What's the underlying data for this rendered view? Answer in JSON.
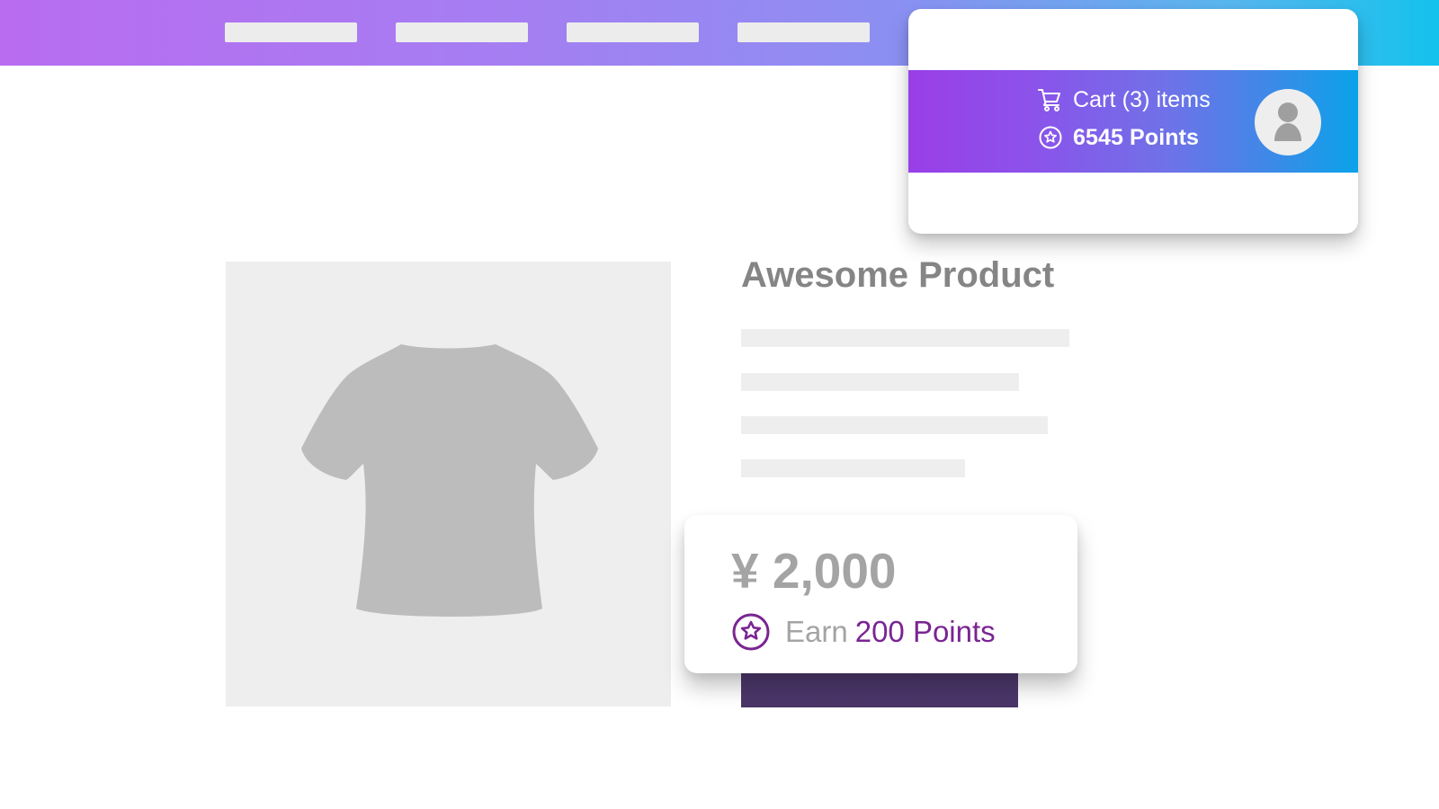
{
  "header": {
    "account_panel": {
      "cart_label": "Cart (3) items",
      "points_label": "6545 Points"
    }
  },
  "product": {
    "title": "Awesome Product",
    "price": "¥ 2,000",
    "earn_prefix": "Earn",
    "earn_points": "200 Points"
  },
  "icons": {
    "cart": "cart-icon",
    "points": "star-icon",
    "avatar": "user-icon",
    "product": "tshirt-icon"
  },
  "colors": {
    "nav_gradient_start": "#b96cf0",
    "nav_gradient_end": "#14c2ed",
    "account_gradient_start": "#9a3ee8",
    "account_gradient_end": "#0aa3ea",
    "accent_purple": "#7a2592",
    "price_gray": "#a4a4a4",
    "title_gray": "#858585",
    "placeholder_gray": "#eeeeee",
    "button_purple": "#4f3a6f"
  }
}
